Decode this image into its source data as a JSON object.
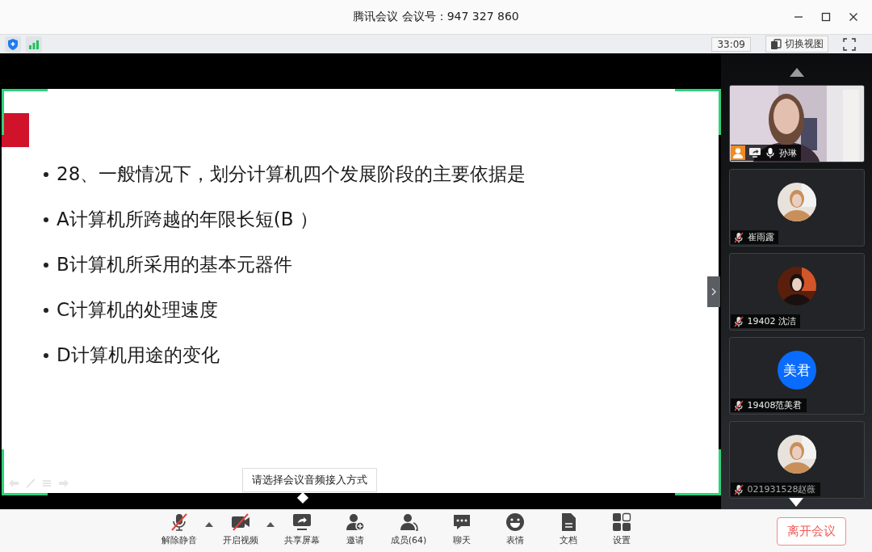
{
  "window": {
    "title": "腾讯会议 会议号：947 327 860"
  },
  "status_bar": {
    "timer": "33:09",
    "view_button": "切换视图"
  },
  "slide": {
    "lines": [
      "28、一般情况下，划分计算机四个发展阶段的主要依据是",
      "A计算机所跨越的年限长短(B ）",
      "B计算机所采用的基本元器件",
      "C计算机的处理速度",
      "D计算机用途的变化"
    ]
  },
  "tooltip": "请选择会议音频接入方式",
  "participants": [
    {
      "name": "孙琳",
      "kind": "video",
      "muted": false,
      "host": true,
      "sharing": true
    },
    {
      "name": "崔雨露",
      "muted": true,
      "host": false,
      "sharing": false
    },
    {
      "name": "19402 沈洁",
      "muted": true,
      "host": false,
      "sharing": false
    },
    {
      "name": "19408范美君",
      "kind": "initials",
      "initials": "美君",
      "muted": true,
      "host": false,
      "sharing": false
    },
    {
      "name": "021931528赵薇",
      "muted": true,
      "host": false,
      "sharing": false
    }
  ],
  "toolbar": [
    {
      "label": "解除静音",
      "kind": "mic",
      "off": true,
      "has_menu": true
    },
    {
      "label": "开启视频",
      "kind": "camera",
      "off": true,
      "has_menu": true
    },
    {
      "label": "共享屏幕",
      "kind": "share",
      "off": false,
      "has_menu": false
    },
    {
      "label": "邀请",
      "kind": "invite",
      "off": false,
      "has_menu": false
    },
    {
      "label": "成员(64)",
      "kind": "members",
      "off": false,
      "has_menu": false
    },
    {
      "label": "聊天",
      "kind": "chat",
      "off": false,
      "has_menu": false
    },
    {
      "label": "表情",
      "kind": "emoji",
      "off": false,
      "has_menu": false
    },
    {
      "label": "文档",
      "kind": "docs",
      "off": false,
      "has_menu": false
    },
    {
      "label": "设置",
      "kind": "settings",
      "off": false,
      "has_menu": false
    }
  ],
  "leave_button": "离开会议"
}
